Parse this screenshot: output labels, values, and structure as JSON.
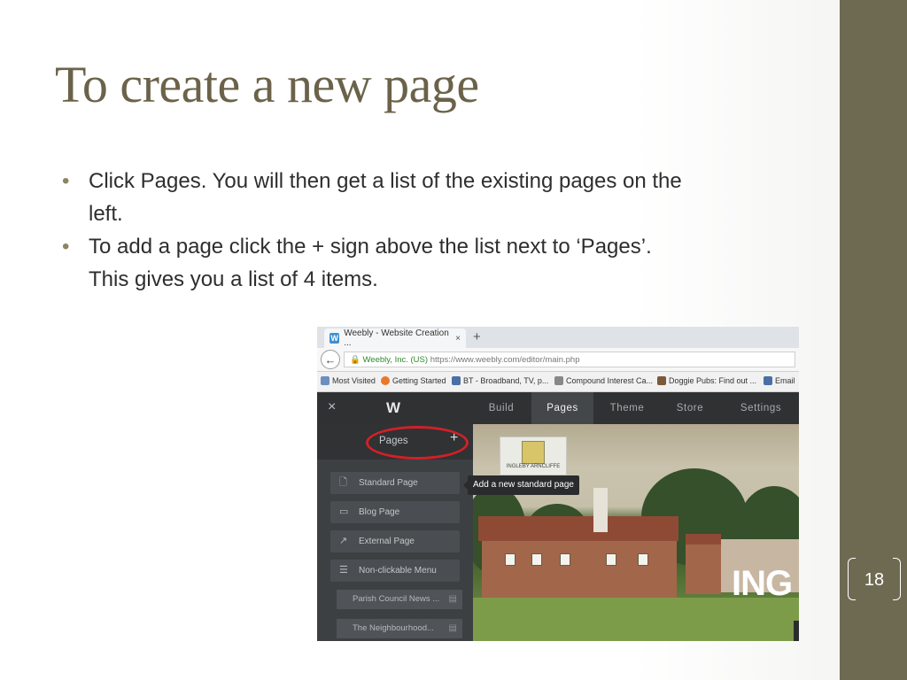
{
  "slide": {
    "title": "To create a new page",
    "bullets": [
      {
        "line1": "Click Pages. You will then get a list of the existing pages on the",
        "line2": "left."
      },
      {
        "line1": "To add a page click the + sign above the list next to ‘Pages’.",
        "line2": "This gives you a list of 4 items."
      }
    ],
    "slide_number": "18",
    "accent_color": "#6e6a52"
  },
  "screenshot": {
    "browser": {
      "tab_title": "Weebly - Website Creation ...",
      "tab_close": "×",
      "new_tab": "+",
      "back": "←",
      "url_org": "Weebly, Inc. (US)",
      "url": "https://www.weebly.com/editor/main.php",
      "bookmarks": [
        "Most Visited",
        "Getting Started",
        "BT - Broadband, TV, p...",
        "Compound Interest Ca...",
        "Doggie Pubs: Find out ...",
        "Email"
      ]
    },
    "weebly": {
      "close": "×",
      "logo": "W",
      "nav_tabs": [
        "Build",
        "Pages",
        "Theme",
        "Store",
        "Settings"
      ],
      "active_tab": "Pages",
      "panel_title": "Pages",
      "add_button": "+",
      "add_menu": [
        {
          "label": "Standard Page",
          "icon": "page-icon"
        },
        {
          "label": "Blog Page",
          "icon": "blog-icon"
        },
        {
          "label": "External Page",
          "icon": "external-link-icon"
        },
        {
          "label": "Non-clickable Menu",
          "icon": "menu-list-icon"
        }
      ],
      "existing_pages": [
        "Parish Council News ...",
        "The Neighbourhood..."
      ],
      "tooltip": "Add a new standard page",
      "site_logo_text": "INGLEBY ARNCLIFFE",
      "site_name_partial": "ING"
    }
  }
}
